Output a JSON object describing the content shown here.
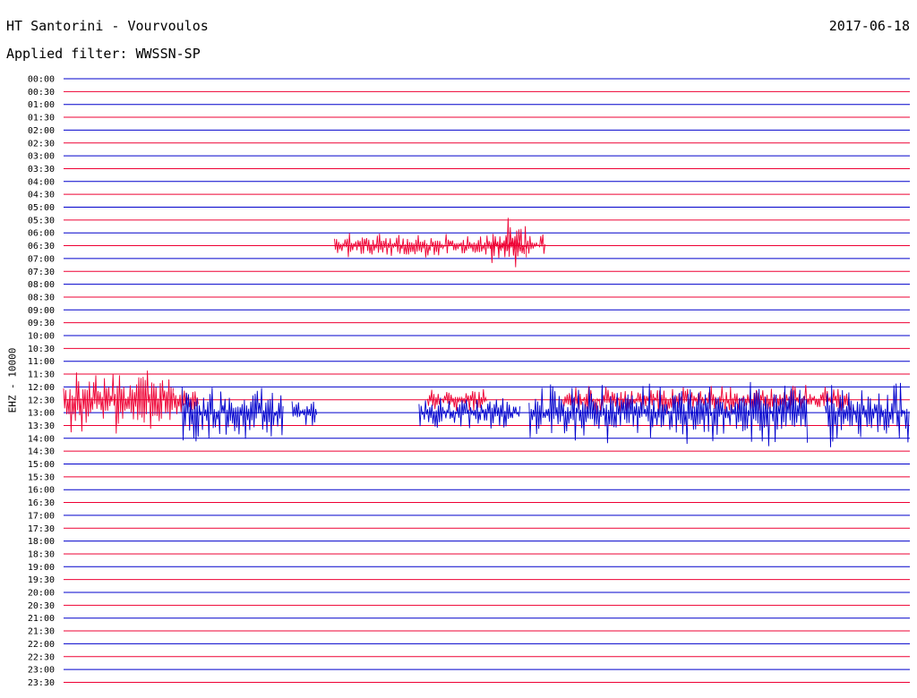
{
  "header": {
    "title": "HT Santorini - Vourvoulos",
    "date": "2017-06-18",
    "filter": "Applied filter: WWSSN-SP"
  },
  "chart_data": {
    "type": "line",
    "subtype": "helicorder",
    "title": "HT Santorini - Vourvoulos",
    "date": "2017-06-18",
    "filter": "WWSSN-SP",
    "ylabel": "EHZ - 10000",
    "row_interval_minutes": 30,
    "rows": [
      "00:00",
      "00:30",
      "01:00",
      "01:30",
      "02:00",
      "02:30",
      "03:00",
      "03:30",
      "04:00",
      "04:30",
      "05:00",
      "05:30",
      "06:00",
      "06:30",
      "07:00",
      "07:30",
      "08:00",
      "08:30",
      "09:00",
      "09:30",
      "10:00",
      "10:30",
      "11:00",
      "11:30",
      "12:00",
      "12:30",
      "13:00",
      "13:30",
      "14:00",
      "14:30",
      "15:00",
      "15:30",
      "16:00",
      "16:30",
      "17:00",
      "17:30",
      "18:00",
      "18:30",
      "19:00",
      "19:30",
      "20:00",
      "20:30",
      "21:00",
      "21:30",
      "22:00",
      "22:30",
      "23:00",
      "23:30"
    ],
    "row_colors": [
      "#0000cc",
      "#ee0033"
    ],
    "traces": [
      {
        "row": "06:30",
        "color": "#ee0033",
        "activity": [
          [
            0.32,
            0.57,
            0.25
          ],
          [
            0.505,
            0.548,
            0.9
          ]
        ]
      },
      {
        "row": "12:30",
        "color": "#ee0033",
        "activity": [
          [
            0.0,
            0.13,
            1.0
          ],
          [
            0.13,
            0.16,
            0.4
          ],
          [
            0.43,
            0.5,
            0.2
          ],
          [
            0.59,
            0.93,
            0.3
          ]
        ]
      },
      {
        "row": "13:00",
        "color": "#0000cc",
        "activity": [
          [
            0.14,
            0.26,
            1.0
          ],
          [
            0.27,
            0.3,
            0.4
          ],
          [
            0.42,
            0.54,
            0.4
          ],
          [
            0.55,
            0.88,
            1.0
          ],
          [
            0.9,
            1.0,
            1.0
          ]
        ]
      }
    ],
    "grid": true
  }
}
